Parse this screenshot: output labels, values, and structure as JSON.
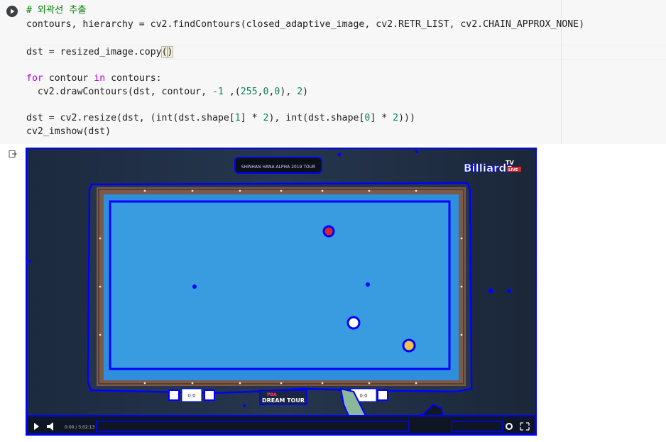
{
  "code_cell": {
    "lines": [
      {
        "parts": [
          {
            "t": "# 외곽선 추출",
            "c": "comment"
          }
        ]
      },
      {
        "parts": [
          {
            "t": "contours, hierarchy = cv2.findContours(closed_adaptive_image, cv2.RETR_LIST, cv2.CHAIN_APPROX_NONE)",
            "c": ""
          }
        ]
      },
      {
        "parts": []
      },
      {
        "parts": [
          {
            "t": "dst = resized_image.copy",
            "c": ""
          },
          {
            "t": "(",
            "c": "paren"
          },
          {
            "t": ")",
            "c": "paren"
          }
        ]
      },
      {
        "parts": []
      },
      {
        "parts": [
          {
            "t": "for",
            "c": "kw"
          },
          {
            "t": " contour ",
            "c": ""
          },
          {
            "t": "in",
            "c": "kw"
          },
          {
            "t": " contours:",
            "c": ""
          }
        ]
      },
      {
        "parts": [
          {
            "t": "  cv2.drawContours(dst, contour, ",
            "c": ""
          },
          {
            "t": "-1",
            "c": "num"
          },
          {
            "t": " ,(",
            "c": ""
          },
          {
            "t": "255",
            "c": "num"
          },
          {
            "t": ",",
            "c": ""
          },
          {
            "t": "0",
            "c": "num"
          },
          {
            "t": ",",
            "c": ""
          },
          {
            "t": "0",
            "c": "num"
          },
          {
            "t": "), ",
            "c": ""
          },
          {
            "t": "2",
            "c": "num"
          },
          {
            "t": ")",
            "c": ""
          }
        ]
      },
      {
        "parts": []
      },
      {
        "parts": [
          {
            "t": "dst = cv2.resize(dst, (int(dst.shape[",
            "c": ""
          },
          {
            "t": "1",
            "c": "num"
          },
          {
            "t": "] * ",
            "c": ""
          },
          {
            "t": "2",
            "c": "num"
          },
          {
            "t": "), int(dst.shape[",
            "c": ""
          },
          {
            "t": "0",
            "c": "num"
          },
          {
            "t": "] * ",
            "c": ""
          },
          {
            "t": "2",
            "c": "num"
          },
          {
            "t": ")))",
            "c": ""
          }
        ]
      },
      {
        "parts": [
          {
            "t": "cv2_imshow(dst)",
            "c": ""
          }
        ]
      }
    ]
  },
  "icons": {
    "run": "play-circle-icon",
    "output": "output-arrow-icon",
    "player_play": "play-icon",
    "player_volume": "volume-icon",
    "player_settings": "gear-icon",
    "player_fullscreen": "fullscreen-icon"
  },
  "output_image": {
    "watermark_main": "Billiards",
    "watermark_tv": "TV",
    "watermark_live": "LIVE",
    "banner_top_text": "SHINHAN HANA ALPHA 2019 TOUR",
    "banner_bottom_line1": "PBA",
    "banner_bottom_line2": "DREAM TOUR",
    "score_left": "0:0",
    "score_right": "0:0",
    "player_time": "0:00 / 3:02:13",
    "colors": {
      "contour": "#0000ff",
      "cloth": "#2f8fdd",
      "inner_cloth": "#3a9ce0",
      "rail": "#7a5a4a",
      "background": "#233045"
    }
  }
}
